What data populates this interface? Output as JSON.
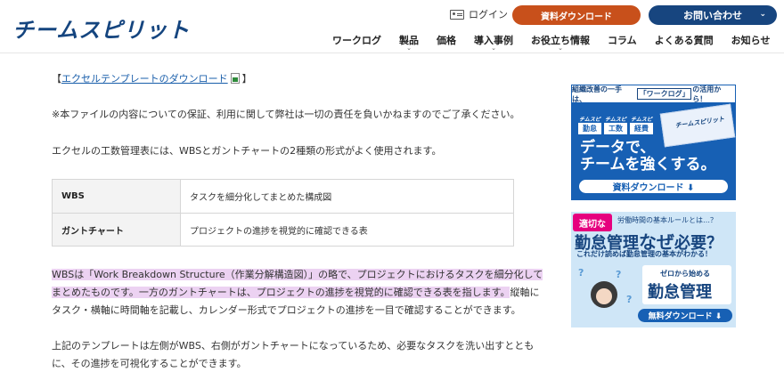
{
  "header": {
    "logo": "チームスピリット",
    "login_label": "ログイン",
    "download_button": "資料ダウンロード",
    "contact_button": "お問い合わせ",
    "nav": [
      {
        "label": "ワークログ",
        "has_dropdown": false
      },
      {
        "label": "製品",
        "has_dropdown": true
      },
      {
        "label": "価格",
        "has_dropdown": false
      },
      {
        "label": "導入事例",
        "has_dropdown": true
      },
      {
        "label": "お役立ち情報",
        "has_dropdown": true
      },
      {
        "label": "コラム",
        "has_dropdown": false
      },
      {
        "label": "よくある質問",
        "has_dropdown": false
      },
      {
        "label": "お知らせ",
        "has_dropdown": false
      }
    ]
  },
  "content": {
    "template_link_open": "【",
    "template_link": "エクセルテンプレートのダウンロード",
    "template_link_close": "】",
    "disclaimer": "※本ファイルの内容についての保証、利用に関して弊社は一切の責任を負いかねますのでご了承ください。",
    "intro": "エクセルの工数管理表には、WBSとガントチャートの2種類の形式がよく使用されます。",
    "table": [
      {
        "term": "WBS",
        "desc": "タスクを細分化してまとめた構成図"
      },
      {
        "term": "ガントチャート",
        "desc": "プロジェクトの進捗を視覚的に確認できる表"
      }
    ],
    "para1_line1": "WBSは「Work Breakdown Structure（作業分解構造図）」の略で、プロジェクトにおけるタスクを細分化して",
    "para1_line2_hl": "まとめたものです。一方のガントチャートは、プロジェクトの進捗を視覚的に確認できる表を指します。",
    "para1_line2_rest": "縦軸に",
    "para1_line3": "タスク・横軸に時間軸を記載し、カレンダー形式でプロジェクトの進捗を一目で確認することができます。",
    "para2_line1": "上記のテンプレートは左側がWBS、右側がガントチャートになっているため、必要なタスクを洗い出すととも",
    "para2_line2": "に、その進捗を可視化することができます。"
  },
  "banner1": {
    "top_pre": "組織改善の一手は、",
    "top_tag": "「ワークログ」",
    "top_post": "の活用から！",
    "tags": [
      {
        "top": "チムスピ",
        "bottom": "勤怠"
      },
      {
        "top": "チムスピ",
        "bottom": "工数"
      },
      {
        "top": "チムスピ",
        "bottom": "経費"
      }
    ],
    "card_logo": "チームスピリット",
    "headline1": "データで、",
    "headline2": "チームを強くする。",
    "button": "資料ダウンロード ⬇"
  },
  "banner2": {
    "badge": "適切な",
    "sub": "労働時間の基本ルールとは…？",
    "title_a": "勤怠管理",
    "title_b": "なぜ",
    "title_c": "必要？",
    "line": "これだけ読めば勤怠管理の基本がわかる！",
    "book_sub": "ゼロから始める",
    "book_main": "勤怠管理",
    "button": "無料ダウンロード ⬇"
  }
}
